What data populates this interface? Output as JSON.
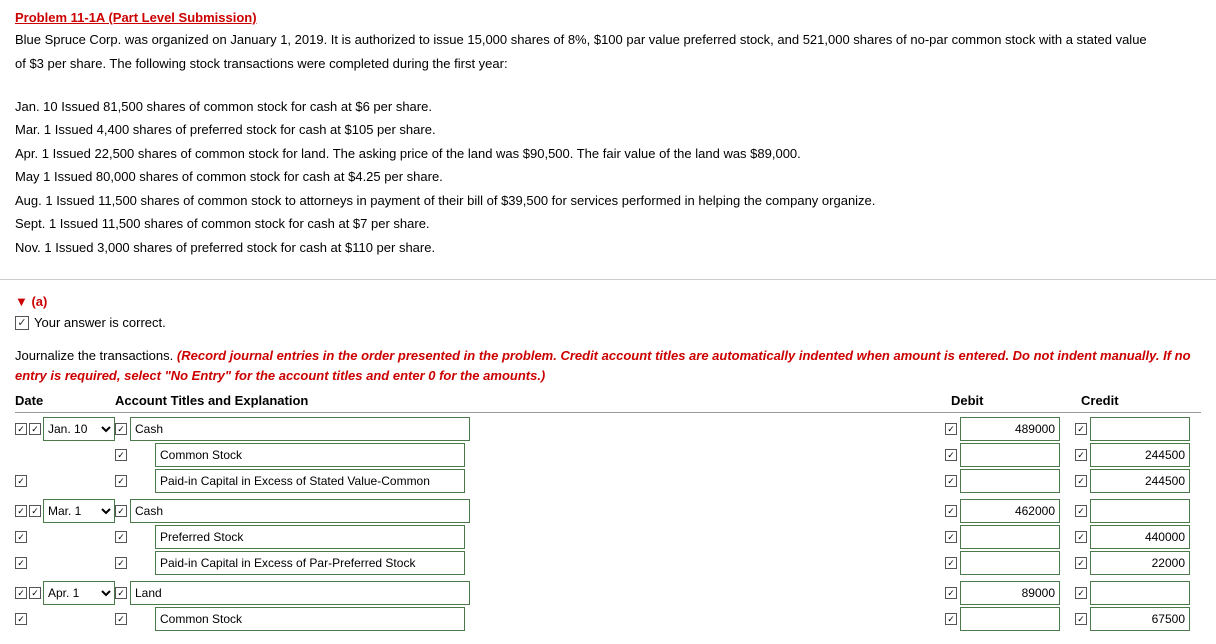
{
  "problem": {
    "title": "Problem 11-1A (Part Level Submission)",
    "description_lines": [
      "Blue Spruce Corp. was organized on January 1, 2019. It is authorized to issue 15,000 shares of 8%, $100 par value preferred stock, and 521,000 shares of no-par common stock with a stated value",
      "of $3 per share. The following stock transactions were completed during the first year:"
    ],
    "transactions": [
      "Jan. 10  Issued 81,500 shares of common stock for cash at $6 per share.",
      "Mar.  1  Issued 4,400 shares of preferred stock for cash at $105 per share.",
      "Apr.  1  Issued 22,500 shares of common stock for land. The asking price of the land was $90,500. The fair value of the land was $89,000.",
      "May   1  Issued 80,000 shares of common stock for cash at $4.25 per share.",
      "Aug.  1  Issued 11,500 shares of common stock to attorneys in payment of their bill of $39,500 for services performed in helping the company organize.",
      "Sept. 1  Issued 11,500 shares of common stock for cash at $7 per share.",
      "Nov.  1  Issued 3,000 shares of preferred stock for cash at $110 per share."
    ]
  },
  "section_a": {
    "label": "▼ (a)",
    "correct_text": "Your answer is correct.",
    "instructions_normal": "Journalize the transactions.",
    "instructions_italic": "(Record journal entries in the order presented in the problem. Credit account titles are automatically indented when amount is entered. Do not indent manually. If no entry is required, select \"No Entry\" for the account titles and enter 0 for the amounts.)"
  },
  "table": {
    "headers": {
      "date": "Date",
      "account": "Account Titles and Explanation",
      "debit": "Debit",
      "credit": "Credit"
    },
    "entries": [
      {
        "id": "jan10",
        "date_value": "Jan. 10",
        "rows": [
          {
            "level": 0,
            "account": "Cash",
            "debit": "489000",
            "credit": ""
          },
          {
            "level": 1,
            "account": "Common Stock",
            "debit": "",
            "credit": "244500"
          },
          {
            "level": 1,
            "account": "Paid-in Capital in Excess of Stated Value-Common",
            "debit": "",
            "credit": "244500"
          }
        ]
      },
      {
        "id": "mar1",
        "date_value": "Mar. 1",
        "rows": [
          {
            "level": 0,
            "account": "Cash",
            "debit": "462000",
            "credit": ""
          },
          {
            "level": 1,
            "account": "Preferred Stock",
            "debit": "",
            "credit": "440000"
          },
          {
            "level": 1,
            "account": "Paid-in Capital in Excess of Par-Preferred Stock",
            "debit": "",
            "credit": "22000"
          }
        ]
      },
      {
        "id": "apr1",
        "date_value": "Apr. 1",
        "rows": [
          {
            "level": 0,
            "account": "Land",
            "debit": "89000",
            "credit": ""
          },
          {
            "level": 1,
            "account": "Common Stock",
            "debit": "",
            "credit": "67500"
          }
        ]
      }
    ]
  }
}
